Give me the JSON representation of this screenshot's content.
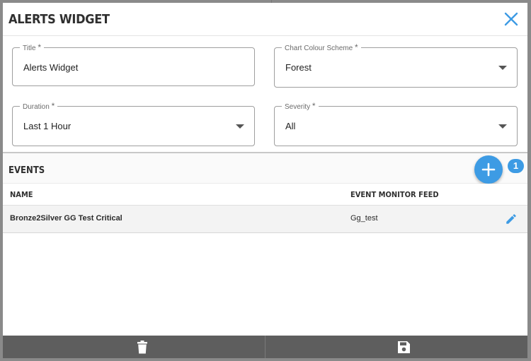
{
  "dialog": {
    "title": "ALERTS WIDGET",
    "close_icon": "close-icon"
  },
  "form": {
    "title_field": {
      "label": "Title",
      "required_mark": "*",
      "value": "Alerts Widget"
    },
    "colour_scheme_field": {
      "label": "Chart Colour Scheme",
      "required_mark": "*",
      "value": "Forest"
    },
    "duration_field": {
      "label": "Duration",
      "required_mark": "*",
      "value": "Last 1 Hour"
    },
    "severity_field": {
      "label": "Severity",
      "required_mark": "*",
      "value": "All"
    }
  },
  "events": {
    "title": "EVENTS",
    "add_icon": "plus-icon",
    "count": "1",
    "columns": [
      "NAME",
      "EVENT MONITOR FEED"
    ],
    "rows": [
      {
        "name": "Bronze2Silver GG Test Critical",
        "feed": "Gg_test",
        "edit_icon": "pencil-icon"
      }
    ]
  },
  "footer": {
    "delete_icon": "trash-icon",
    "save_icon": "floppy-disk-icon"
  },
  "colors": {
    "accent": "#3d9be4",
    "footer_bg": "#5e5e5e",
    "overlay": "#8a8a8a"
  }
}
